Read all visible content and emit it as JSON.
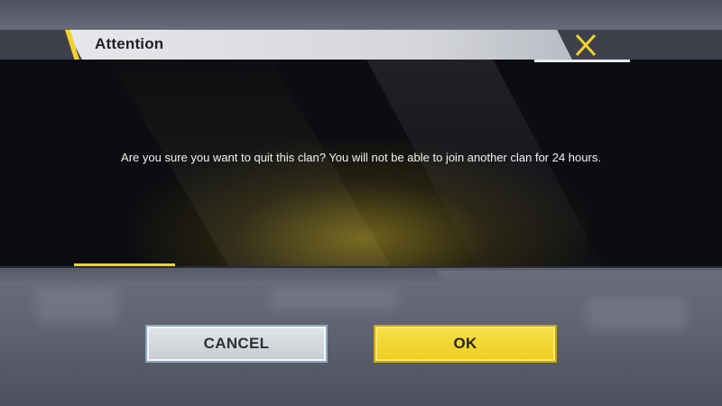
{
  "dialog": {
    "title": "Attention",
    "message": "Are you sure you want to quit this clan? You will not be able to join another clan for 24 hours.",
    "close_icon": "close-x-icon"
  },
  "buttons": {
    "cancel_label": "CANCEL",
    "ok_label": "OK"
  },
  "colors": {
    "accent_yellow": "#f2d22a",
    "dialog_background": "#0c0d10",
    "cancel_button": "#d6dade",
    "ok_button": "#f3d63a"
  }
}
